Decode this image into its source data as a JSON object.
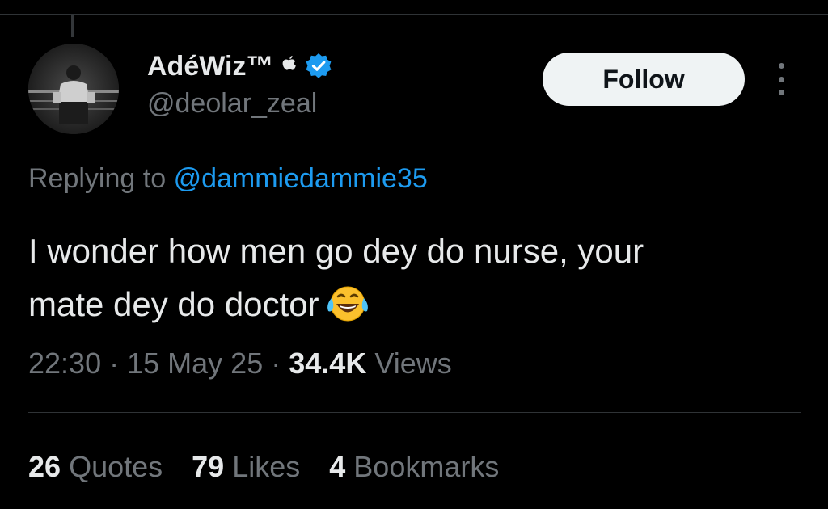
{
  "tweet": {
    "author": {
      "display_name": "AdéWiz™",
      "badge_glyph": "",
      "handle": "@deolar_zeal",
      "avatar_icon": "avatar-photo",
      "verified_color": "#1d9bf0"
    },
    "follow_label": "Follow",
    "more_icon": "more-vertical-icon",
    "replying_prefix": "Replying to",
    "replying_to": "@dammiedammie35",
    "text_line1": "I wonder how men go dey do nurse, your",
    "text_line2": "mate dey do doctor",
    "emoji": "face-with-tears-of-joy",
    "time": "22:30",
    "separator": "·",
    "date": "15 May 25",
    "views_count": "34.4K",
    "views_label": "Views"
  },
  "stats": [
    {
      "count": "26",
      "label": "Quotes"
    },
    {
      "count": "79",
      "label": "Likes"
    },
    {
      "count": "4",
      "label": "Bookmarks"
    }
  ],
  "colors": {
    "background": "#000000",
    "primary_text": "#e7e9ea",
    "secondary_text": "#71767b",
    "link": "#1d9bf0",
    "follow_button_bg": "#eff3f4"
  }
}
